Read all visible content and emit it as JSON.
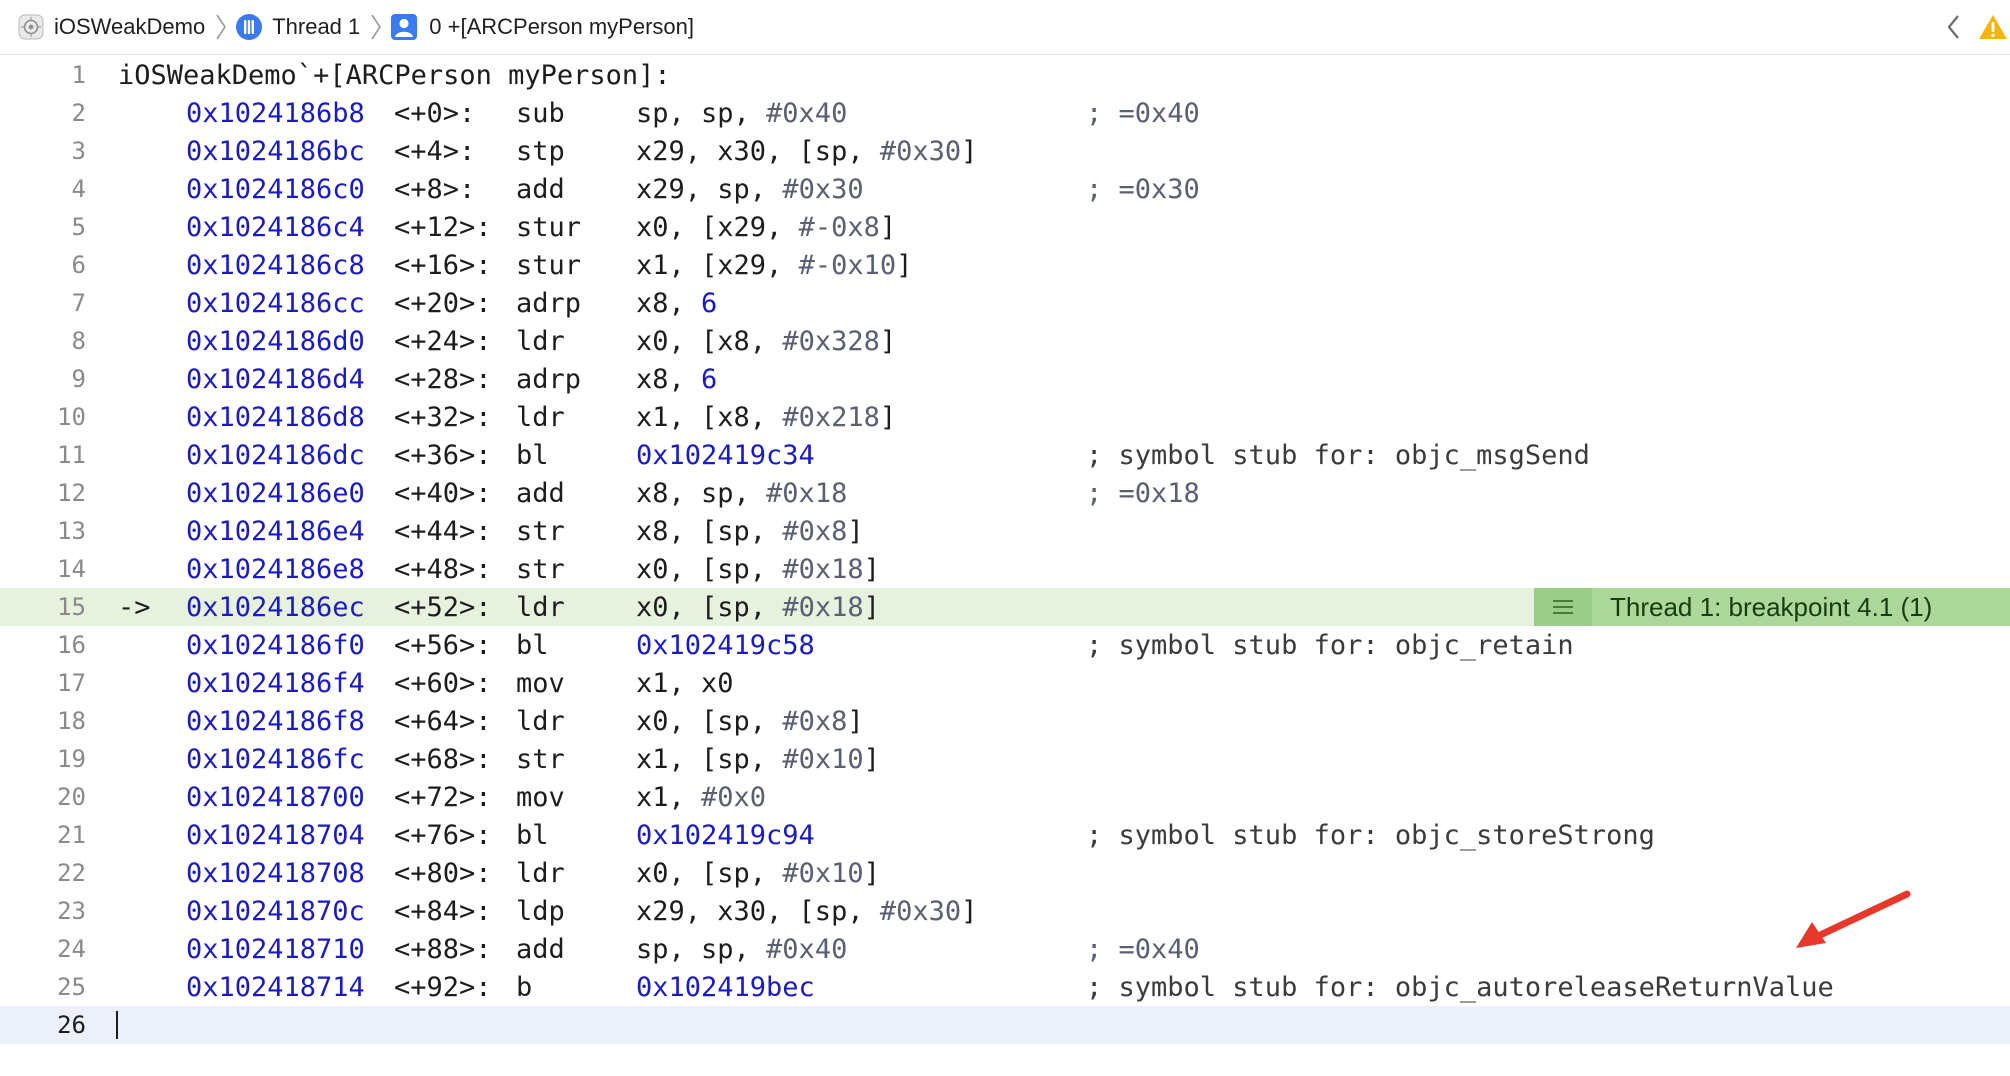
{
  "jumpbar": {
    "app": "iOSWeakDemo",
    "thread": "Thread 1",
    "frame": "0 +[ARCPerson myPerson]"
  },
  "header_text": "iOSWeakDemo`+[ARCPerson myPerson]:",
  "lines": [
    {
      "n": "1"
    },
    {
      "n": "2",
      "addr": "0x1024186b8",
      "off": "<+0>:",
      "mn": "sub",
      "ops": "sp, sp, #0x40",
      "cmt": "; =0x40"
    },
    {
      "n": "3",
      "addr": "0x1024186bc",
      "off": "<+4>:",
      "mn": "stp",
      "ops": "x29, x30, [sp, #0x30]"
    },
    {
      "n": "4",
      "addr": "0x1024186c0",
      "off": "<+8>:",
      "mn": "add",
      "ops": "x29, sp, #0x30",
      "cmt": "; =0x30"
    },
    {
      "n": "5",
      "addr": "0x1024186c4",
      "off": "<+12>:",
      "mn": "stur",
      "ops": "x0, [x29, #-0x8]"
    },
    {
      "n": "6",
      "addr": "0x1024186c8",
      "off": "<+16>:",
      "mn": "stur",
      "ops": "x1, [x29, #-0x10]"
    },
    {
      "n": "7",
      "addr": "0x1024186cc",
      "off": "<+20>:",
      "mn": "adrp",
      "ops": "x8, 6"
    },
    {
      "n": "8",
      "addr": "0x1024186d0",
      "off": "<+24>:",
      "mn": "ldr",
      "ops": "x0, [x8, #0x328]"
    },
    {
      "n": "9",
      "addr": "0x1024186d4",
      "off": "<+28>:",
      "mn": "adrp",
      "ops": "x8, 6"
    },
    {
      "n": "10",
      "addr": "0x1024186d8",
      "off": "<+32>:",
      "mn": "ldr",
      "ops": "x1, [x8, #0x218]"
    },
    {
      "n": "11",
      "addr": "0x1024186dc",
      "off": "<+36>:",
      "mn": "bl",
      "ops": "0x102419c34",
      "cmt": "; symbol stub for: objc_msgSend"
    },
    {
      "n": "12",
      "addr": "0x1024186e0",
      "off": "<+40>:",
      "mn": "add",
      "ops": "x8, sp, #0x18",
      "cmt": "; =0x18"
    },
    {
      "n": "13",
      "addr": "0x1024186e4",
      "off": "<+44>:",
      "mn": "str",
      "ops": "x8, [sp, #0x8]"
    },
    {
      "n": "14",
      "addr": "0x1024186e8",
      "off": "<+48>:",
      "mn": "str",
      "ops": "x0, [sp, #0x18]"
    },
    {
      "n": "15",
      "addr": "0x1024186ec",
      "off": "<+52>:",
      "mn": "ldr",
      "ops": "x0, [sp, #0x18]"
    },
    {
      "n": "16",
      "addr": "0x1024186f0",
      "off": "<+56>:",
      "mn": "bl",
      "ops": "0x102419c58",
      "cmt": "; symbol stub for: objc_retain"
    },
    {
      "n": "17",
      "addr": "0x1024186f4",
      "off": "<+60>:",
      "mn": "mov",
      "ops": "x1, x0"
    },
    {
      "n": "18",
      "addr": "0x1024186f8",
      "off": "<+64>:",
      "mn": "ldr",
      "ops": "x0, [sp, #0x8]"
    },
    {
      "n": "19",
      "addr": "0x1024186fc",
      "off": "<+68>:",
      "mn": "str",
      "ops": "x1, [sp, #0x10]"
    },
    {
      "n": "20",
      "addr": "0x102418700",
      "off": "<+72>:",
      "mn": "mov",
      "ops": "x1, #0x0"
    },
    {
      "n": "21",
      "addr": "0x102418704",
      "off": "<+76>:",
      "mn": "bl",
      "ops": "0x102419c94",
      "cmt": "; symbol stub for: objc_storeStrong"
    },
    {
      "n": "22",
      "addr": "0x102418708",
      "off": "<+80>:",
      "mn": "ldr",
      "ops": "x0, [sp, #0x10]"
    },
    {
      "n": "23",
      "addr": "0x10241870c",
      "off": "<+84>:",
      "mn": "ldp",
      "ops": "x29, x30, [sp, #0x30]"
    },
    {
      "n": "24",
      "addr": "0x102418710",
      "off": "<+88>:",
      "mn": "add",
      "ops": "sp, sp, #0x40",
      "cmt": "; =0x40"
    },
    {
      "n": "25",
      "addr": "0x102418714",
      "off": "<+92>:",
      "mn": "b",
      "ops": "0x102419bec",
      "cmt": "; symbol stub for: objc_autoreleaseReturnValue"
    },
    {
      "n": "26"
    }
  ],
  "pc_arrow": "->",
  "breakpoint_badge": "Thread 1: breakpoint 4.1 (1)",
  "colors": {
    "address": "#1b1bc4",
    "pc_line_bg": "#e6f2dd",
    "badge_bg": "#abd79a",
    "cursor_line_bg": "#ebf0fb",
    "annotation_arrow": "#e8382c",
    "warning": "#f5b50a"
  },
  "icons": {
    "app": "app-target-icon",
    "thread": "thread-icon",
    "frame": "stack-frame-icon",
    "back": "chevron-left-icon",
    "warning": "warning-triangle-icon",
    "badge": "breakpoint-lines-icon"
  }
}
